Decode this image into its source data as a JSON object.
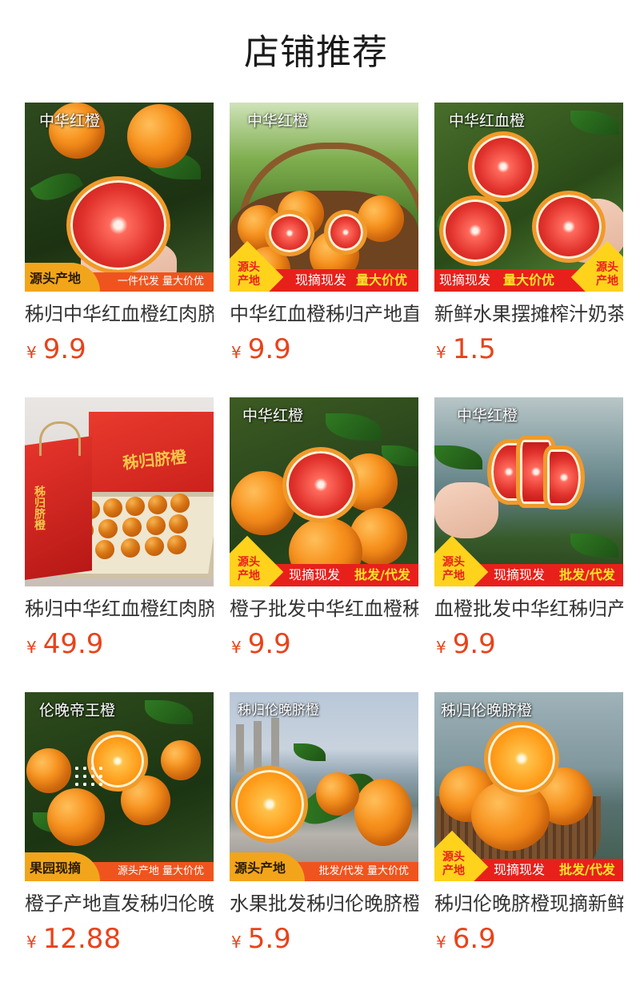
{
  "page": {
    "title": "店铺推荐"
  },
  "products": [
    {
      "overlay": "中华红橙",
      "badge": "源头产地",
      "tag": "一件代发 量大价优",
      "name": "秭归中华红血橙红肉脐橙",
      "currency": "¥",
      "price": "9.9"
    },
    {
      "overlay": "中华红橙",
      "corner": "源头\n产地",
      "tag1": "现摘现发",
      "tag2": "量大价优",
      "name": "中华红血橙秭归产地直发",
      "currency": "¥",
      "price": "9.9"
    },
    {
      "overlay": "中华红血橙",
      "corner": "源头\n产地",
      "tag1": "现摘现发",
      "tag2": "量大价优",
      "name": "新鲜水果摆摊榨汁奶茶店",
      "currency": "¥",
      "price": "1.5"
    },
    {
      "overlay": "",
      "box_text": "秭归脐橙",
      "bag_text": "秭归脐橙",
      "name": "秭归中华红血橙红肉脐橙",
      "currency": "¥",
      "price": "49.9"
    },
    {
      "overlay": "中华红橙",
      "corner": "源头\n产地",
      "tag1": "现摘现发",
      "tag2": "批发/代发",
      "name": "橙子批发中华红血橙秭归",
      "currency": "¥",
      "price": "9.9"
    },
    {
      "overlay": "中华红橙",
      "corner": "源头\n产地",
      "tag1": "现摘现发",
      "tag2": "批发/代发",
      "name": "血橙批发中华红秭归产地",
      "currency": "¥",
      "price": "9.9"
    },
    {
      "overlay": "伦晚帝王橙",
      "badge": "果园现摘",
      "tag": "源头产地 量大价优",
      "name": "橙子产地直发秭归伦晚脐橙",
      "currency": "¥",
      "price": "12.88"
    },
    {
      "overlay": "秭归伦晚脐橙",
      "badge": "源头产地",
      "tag": "批发/代发 量大价优",
      "name": "水果批发秭归伦晚脐橙新鲜",
      "currency": "¥",
      "price": "5.9"
    },
    {
      "overlay": "秭归伦晚脐橙",
      "corner": "源头\n产地",
      "tag1": "现摘现发",
      "tag2": "批发/代发",
      "name": "秭归伦晚脐橙现摘新鲜",
      "currency": "¥",
      "price": "6.9"
    }
  ]
}
